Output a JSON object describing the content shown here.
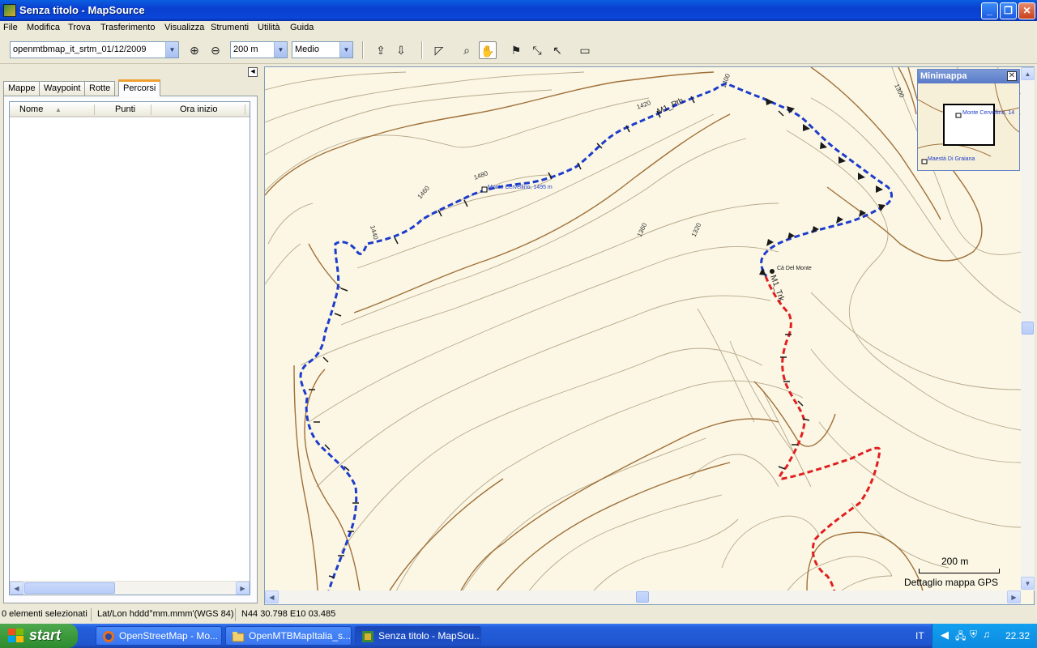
{
  "window": {
    "title": "Senza titolo - MapSource"
  },
  "menu": [
    "File",
    "Modifica",
    "Trova",
    "Trasferimento",
    "Visualizza",
    "Strumenti",
    "Utilità",
    "Guida"
  ],
  "toolbar": {
    "map_select": "openmtbmap_it_srtm_01/12/2009",
    "zoom_level": "200 m",
    "detail_level": "Medio"
  },
  "left_panel": {
    "tabs": [
      "Mappe",
      "Waypoint",
      "Rotte",
      "Percorsi"
    ],
    "active_tab": "Percorsi",
    "columns": [
      "Nome",
      "Punti",
      "Ora inizio"
    ]
  },
  "map": {
    "contour_labels": [
      "1300",
      "1400",
      "1420",
      "1480",
      "1460",
      "1440",
      "1360",
      "1320"
    ],
    "route_label": "M1_Pth",
    "track_label": "M1_Trk",
    "waypoints": [
      "Monte Cervellino, 1495 m",
      "Cà Del Monte"
    ],
    "route_color": "#1e3ccc",
    "track_color": "#e02020",
    "contour_color_major": "#a0703a",
    "contour_color_minor": "#b8a78a",
    "background_color": "#fbf7e4"
  },
  "minimap": {
    "title": "Minimappa",
    "labels": [
      "Monte Cervellino, 14",
      "Maestà Di Graiana"
    ]
  },
  "scale": {
    "label": "200 m",
    "detail": "Dettaglio mappa GPS"
  },
  "status": {
    "selected": "0 elementi selezionati",
    "format": "Lat/Lon hddd°mm.mmm'(WGS 84)",
    "coords": "N44 30.798 E10 03.485"
  },
  "taskbar": {
    "start": "start",
    "items": [
      "OpenStreetMap - Mo...",
      "OpenMTBMapItalia_s...",
      "Senza titolo - MapSou..."
    ],
    "language": "IT",
    "clock": "22.32"
  }
}
